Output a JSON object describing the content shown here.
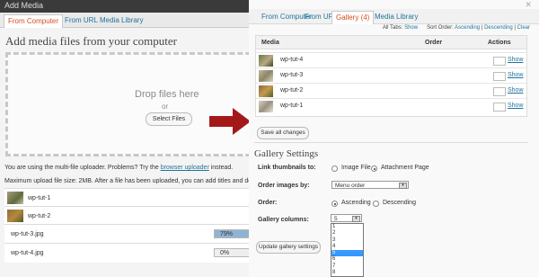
{
  "left": {
    "window_title": "Add Media",
    "tabs": [
      "From Computer",
      "From URL",
      "Media Library"
    ],
    "heading": "Add media files from your computer",
    "drop_text": "Drop files here",
    "or_text": "or",
    "select_button": "Select Files",
    "uploader_note_prefix": "You are using the multi-file uploader. Problems? Try the",
    "uploader_link": "browser uploader",
    "uploader_note_suffix": "instead.",
    "max_size_text": "Maximum upload file size: 2MB. After a file has been uploaded, you can add titles and de",
    "uploads": [
      {
        "name": "wp-tut-1",
        "thumb": true
      },
      {
        "name": "wp-tut-2",
        "thumb": true
      },
      {
        "name": "wp-tut-3.jpg",
        "progress_label": "79%",
        "progress": 0.79
      },
      {
        "name": "wp-tut-4.jpg",
        "progress_label": "0%",
        "progress": 0
      }
    ]
  },
  "right": {
    "tabs": [
      "From Computer",
      "From URL",
      "Gallery (4)",
      "Media Library"
    ],
    "sort_prefix": "All Tabs:",
    "sort_show": "Show",
    "sort_order_label": "Sort Order:",
    "sort_ascending": "Ascending",
    "sort_descending": "Descending",
    "sort_clear": "Clear",
    "table_headers": {
      "media": "Media",
      "order": "Order",
      "actions": "Actions"
    },
    "rows": [
      {
        "name": "wp-tut-4",
        "action": "Show"
      },
      {
        "name": "wp-tut-3",
        "action": "Show"
      },
      {
        "name": "wp-tut-2",
        "action": "Show"
      },
      {
        "name": "wp-tut-1",
        "action": "Show"
      }
    ],
    "save_button": "Save all changes",
    "gallery_heading": "Gallery Settings",
    "link_label": "Link thumbnails to:",
    "link_options": [
      "Image File",
      "Attachment Page"
    ],
    "link_selected": "Attachment Page",
    "order_by_label": "Order images by:",
    "order_by_value": "Menu order",
    "order_label": "Order:",
    "order_options": [
      "Ascending",
      "Descending"
    ],
    "order_selected": "Ascending",
    "columns_label": "Gallery columns:",
    "columns_value": "5",
    "columns_options": [
      "1",
      "2",
      "3",
      "4",
      "5",
      "6",
      "7",
      "8"
    ],
    "update_button": "Update gallery settings"
  },
  "colors": {
    "accent": "#21759b",
    "active_tab": "#d54e21",
    "arrow": "#a3191a",
    "dropdown_selected": "#3399ff"
  }
}
